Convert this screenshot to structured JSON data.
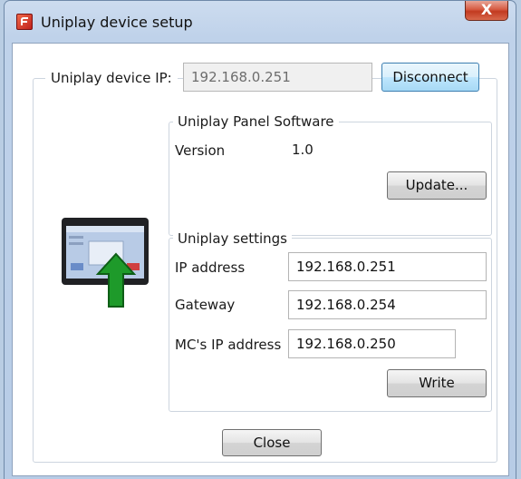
{
  "window": {
    "title": "Uniplay device setup",
    "close_glyph": "X",
    "icons": {
      "app": "uniplay-app-icon",
      "close": "close-icon"
    }
  },
  "connection": {
    "ip_label": "Uniplay device IP:",
    "ip_value": "192.168.0.251",
    "disconnect_label": "Disconnect"
  },
  "software": {
    "group_title": "Uniplay Panel Software",
    "version_label": "Version",
    "version_value": "1.0",
    "update_label": "Update..."
  },
  "settings": {
    "group_title": "Uniplay settings",
    "ip_label": "IP address",
    "ip_value": "192.168.0.251",
    "gateway_label": "Gateway",
    "gateway_value": "192.168.0.254",
    "mc_ip_label": "MC's IP address",
    "mc_ip_value": "192.168.0.250",
    "write_label": "Write"
  },
  "footer": {
    "close_label": "Close"
  },
  "illustration": {
    "icon": "device-upload-icon",
    "arrow_color": "#1e9a2a"
  }
}
